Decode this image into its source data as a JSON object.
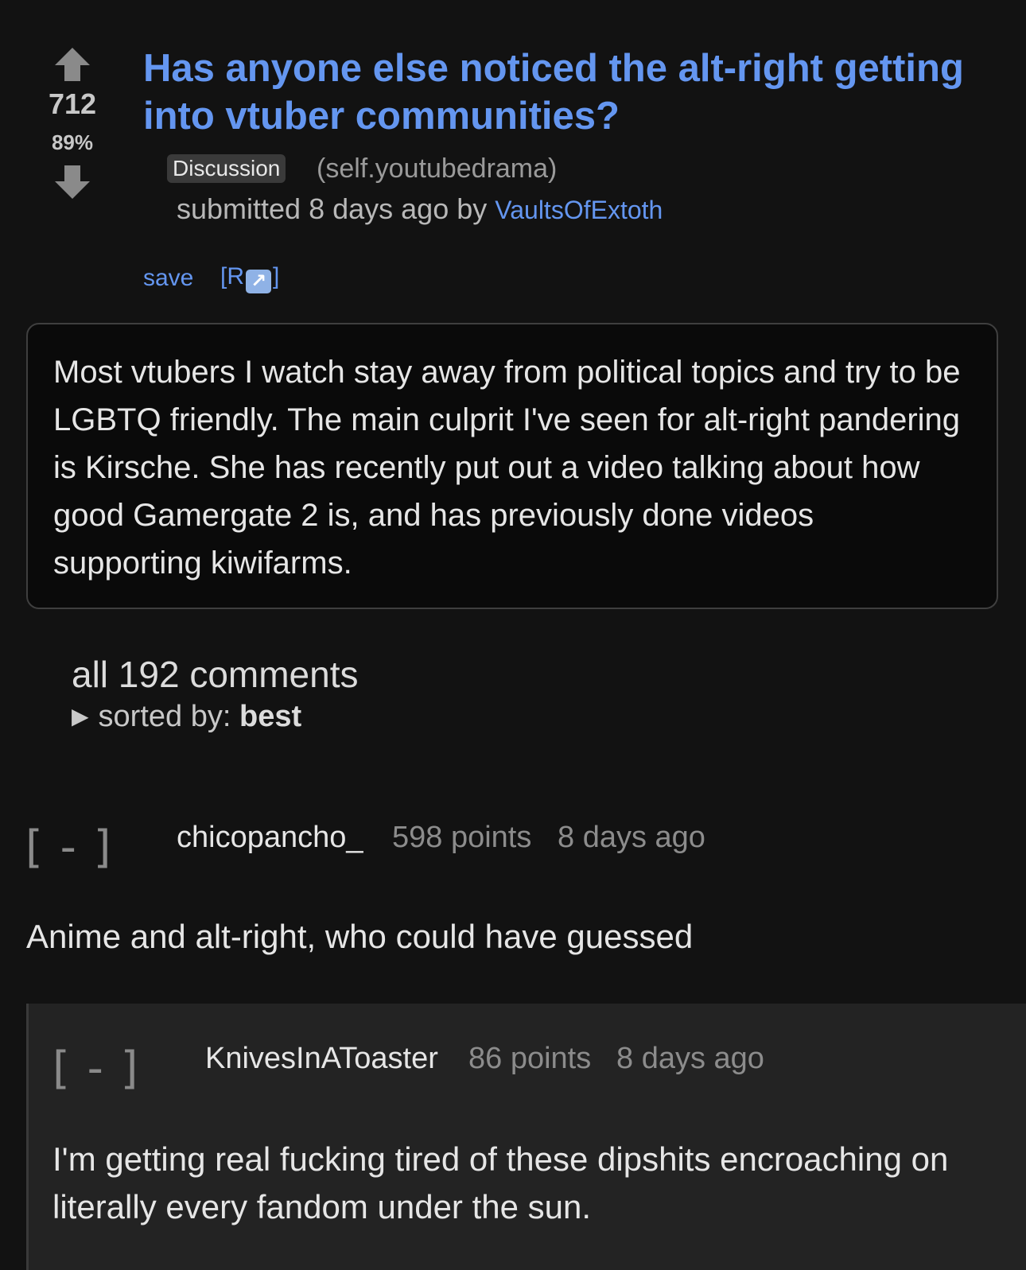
{
  "post": {
    "score": "712",
    "upvote_percent": "89%",
    "title": "Has anyone else noticed the alt-right getting into vtuber communities?",
    "flair": "Discussion",
    "domain": "(self.youtubedrama)",
    "submitted_prefix": "submitted 8 days ago by",
    "author": "VaultsOfExtoth",
    "save_label": "save",
    "r_link_prefix": "[R",
    "r_link_icon": "↗",
    "r_link_suffix": "]",
    "body": "Most vtubers I watch stay away from political topics and try to be LGBTQ friendly. The main culprit I've seen for alt-right pandering is Kirsche. She has recently put out a video talking about how good Gamergate 2 is, and has previously done videos supporting kiwifarms."
  },
  "comments_header": {
    "count_label": "all 192 comments",
    "sort_prefix": "sorted by:",
    "sort_value": "best",
    "sort_toggle_glyph": "▶"
  },
  "comments": [
    {
      "collapse_label": "[ - ]",
      "author": "chicopancho_",
      "points": "598 points",
      "age": "8 days ago",
      "body": "Anime and alt-right, who could have guessed"
    },
    {
      "collapse_label": "[ - ]",
      "author": "KnivesInAToaster",
      "points": "86 points",
      "age": "8 days ago",
      "body": "I'm getting real fucking tired of these dipshits encroaching on literally every fandom under the sun."
    }
  ],
  "icons": {
    "upvote": "upvote-arrow-icon",
    "downvote": "downvote-arrow-icon",
    "external_link": "external-link-icon"
  },
  "colors": {
    "background": "#121212",
    "link": "#6496f0",
    "reply_background": "#232323"
  }
}
